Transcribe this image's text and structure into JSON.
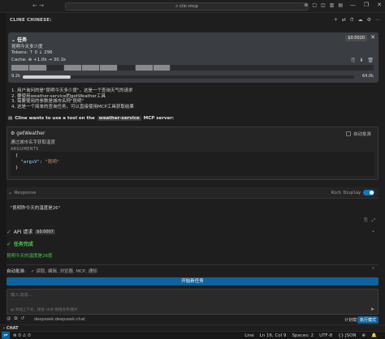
{
  "titlebar": {
    "nav": "← →",
    "search": "⌕ clic-mcp",
    "icons": [
      "⊗",
      "□",
      "◫",
      "▥",
      "▤"
    ],
    "window": [
      "—",
      "❐",
      "✕"
    ]
  },
  "panel": {
    "title": "CLINE CHINESE:",
    "icons": [
      "+",
      "⇄",
      "⏱",
      "☁",
      "⚙",
      "⋯"
    ]
  },
  "task": {
    "heading": "任务",
    "cost": "$0.0020",
    "close": "✕",
    "name": "昆明今天多少度",
    "tokens": "Tokens: ↑ 0 ↓ 296",
    "cache": "Cache: ⊕ +1.0k → 30.1k",
    "card_icons": [
      "⎘",
      "⬇",
      "🗑"
    ],
    "context_used": "9.2k",
    "context_total": "64.0k",
    "context_fraction": 0.144
  },
  "steps": [
    "1. 用户询问的是\"昆明今天多少度\"，这是一个查询天气的请求",
    "2. 要使用weather-service的getWeather工具",
    "3. 需要使用的参数是城市名称\"昆明\"",
    "4. 这是一个简单的查询任务，可以直接使用MCP工具获取结果"
  ],
  "mcp": {
    "prefix": "Cline wants to use a tool on the",
    "server": "weather-service",
    "suffix": "MCP server:"
  },
  "tool": {
    "name": "getWeather",
    "auto_approve": "自动批准",
    "description": "通过城市名字获取温度",
    "args_label": "ARGUMENTS",
    "arg_open": "{",
    "arg_key": "\"argsV\"",
    "arg_sep": ": ",
    "arg_value": "\"昆明\"",
    "arg_close": "}"
  },
  "response": {
    "title": "Response",
    "rich_display": "Rich Display",
    "text": "\"昆明昨今天的温度是26\"",
    "icons": [
      "⎘",
      "⤢"
    ]
  },
  "api": {
    "label": "API 请求",
    "cost": "$0.0007"
  },
  "done": {
    "label": "任务完成",
    "text": "昆明今天的温度是26度"
  },
  "auto_approve_bar": {
    "label": "自动批准:",
    "items": "✓ 读取, 编辑, 浏览器, MCP, 通知"
  },
  "start_button": "开始新任务",
  "input": {
    "placeholder": "输入消息...",
    "hint": "@ 添加上下文，按住 shift 拖拽文件/图片"
  },
  "bottom": {
    "icons": [
      "@",
      "⧉",
      "↺"
    ],
    "model": "deepseek:deepseek-chat",
    "plan": "计划模式",
    "act": "执行模式"
  },
  "chat": "CHAT",
  "status": {
    "left": "⇌",
    "errors": "⊗ 0 ⚠ 0",
    "right": [
      "Line",
      "Ln 16, Col 9",
      "Spaces: 2",
      "UTF-8",
      "{} JSON",
      "⊕",
      "🔔"
    ]
  }
}
